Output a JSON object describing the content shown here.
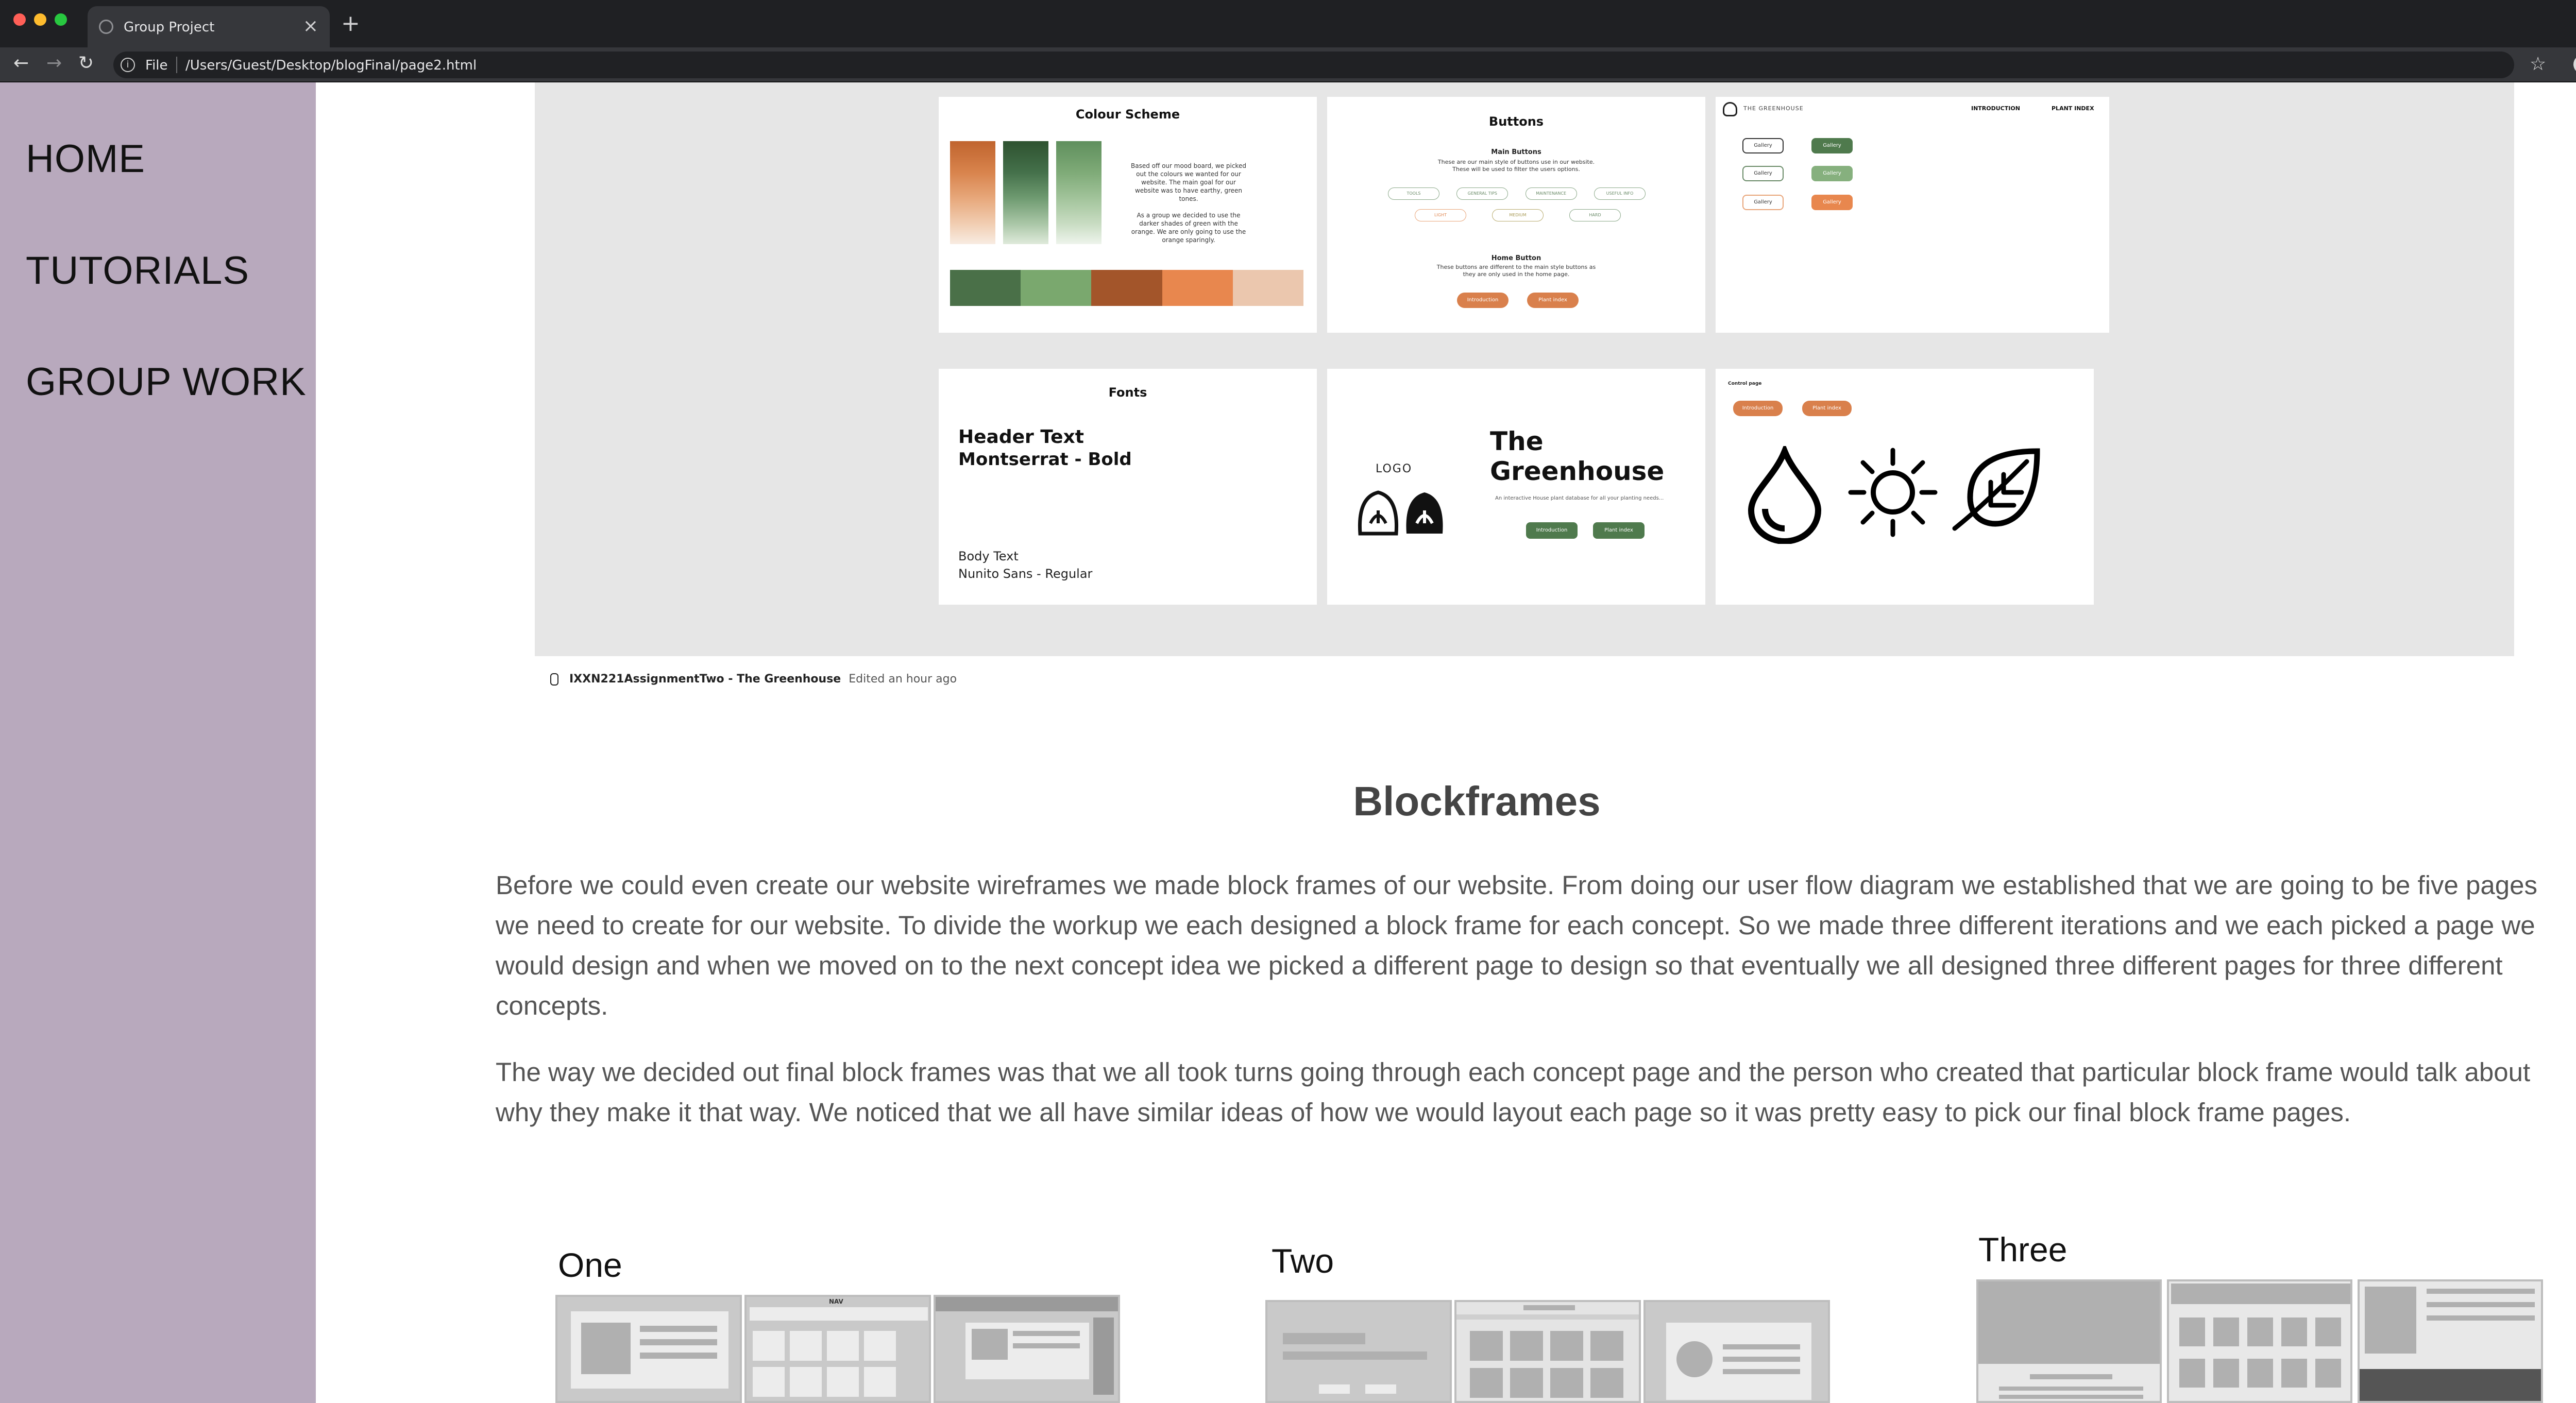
{
  "browser": {
    "tab_title": "Group Project",
    "tab_close": "×",
    "new_tab": "+",
    "url_scheme": "File",
    "url_path": "/Users/Guest/Desktop/blogFinal/page2.html",
    "traffic_colors": [
      "#ff5f57",
      "#febc2e",
      "#28c840"
    ]
  },
  "sidebar": {
    "items": [
      {
        "label": "HOME"
      },
      {
        "label": "TUTORIALS"
      },
      {
        "label": "GROUP WORK"
      }
    ]
  },
  "figma": {
    "colour_card": {
      "title": "Colour Scheme",
      "body": "Based off our mood board, we picked out the colours we wanted for our website. The main goal for our website was to have earthy, green tones.",
      "body2": "As a group we decided to use the darker shades of green with the orange. We are only going to use the orange sparingly.",
      "swatches": [
        "#4a7048",
        "#7aa86e",
        "#a3552a",
        "#e8874e",
        "#ebc7ae"
      ]
    },
    "buttons_card": {
      "title": "Buttons",
      "main_heading": "Main Buttons",
      "main_desc": "These are our main style of buttons use in our website. These will be used to filter the users options.",
      "main_buttons": [
        "TOOLS",
        "GENERAL TIPS",
        "MAINTENANCE",
        "USEFUL INFO",
        "LIGHT",
        "MEDIUM",
        "HARD"
      ],
      "home_heading": "Home Button",
      "home_desc": "These buttons are different to the main style buttons as they are only used in the home page.",
      "home_buttons": [
        "Introduction",
        "Plant index"
      ]
    },
    "nav_card": {
      "brand": "THE GREENHOUSE",
      "nav": [
        "INTRODUCTION",
        "PLANT INDEX"
      ],
      "gallery": "Gallery"
    },
    "fonts_card": {
      "title": "Fonts",
      "header_line1": "Header Text",
      "header_line2": "Montserrat - Bold",
      "body_line1": "Body Text",
      "body_line2": "Nunito Sans - Regular"
    },
    "logo_card": {
      "logo_label": "LOGO",
      "title_line1": "The",
      "title_line2": "Greenhouse",
      "desc": "An interactive House plant database for all your planting needs...",
      "buttons": [
        "Introduction",
        "Plant index"
      ]
    },
    "icons_card": {
      "title": "Control page",
      "buttons": [
        "Introduction",
        "Plant index"
      ]
    },
    "caption_file": "IXXN221AssignmentTwo - The Greenhouse",
    "caption_edited": "Edited an hour ago"
  },
  "main": {
    "heading": "Blockframes",
    "para1": "Before we could even create our website wireframes we made block frames of our website. From doing our user flow diagram we established that we are going to be five pages we need to create for our website. To divide the workup we each designed a block frame for each concept. So we made three different iterations and we each picked a page we would design and when we moved on to the next concept idea we picked a different page to design so that eventually we all designed three different pages for three different concepts.",
    "para2": "The way we decided out final block frames was that we all took turns going through each concept page and the person who created that particular block frame would talk about why they make it that way. We noticed that we all have similar ideas of how we would layout each page so it was pretty easy to pick our final block frame pages.",
    "blockframes": [
      {
        "label": "One",
        "nav": "NAV"
      },
      {
        "label": "Two"
      },
      {
        "label": "Three"
      }
    ]
  }
}
